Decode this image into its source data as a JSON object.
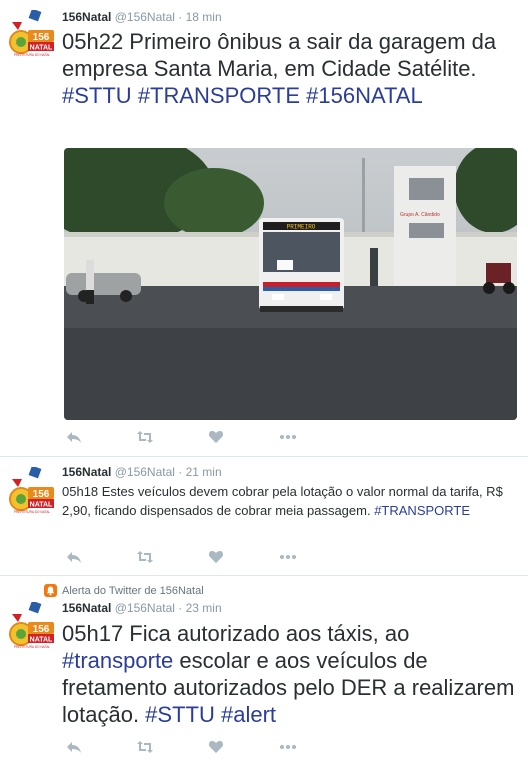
{
  "tweets": [
    {
      "name": "156Natal",
      "handle": "@156Natal",
      "sep": "·",
      "time": "18 min",
      "text_parts": [
        {
          "t": "05h22 Primeiro ônibus a sair da garagem da empresa Santa Maria, em Cidade Satélite. ",
          "ht": false
        },
        {
          "t": "#STTU",
          "ht": true
        },
        {
          "t": " ",
          "ht": false
        },
        {
          "t": "#TRANSPORTE",
          "ht": true
        },
        {
          "t": " ",
          "ht": false
        },
        {
          "t": "#156NATAL",
          "ht": true
        }
      ],
      "photo": {
        "bus_sign": "PRIMEIRO",
        "wall_sign": "Grupo A. Cândido"
      }
    },
    {
      "name": "156Natal",
      "handle": "@156Natal",
      "sep": "·",
      "time": "21 min",
      "text_parts": [
        {
          "t": "05h18 Estes veículos devem cobrar pela lotação o valor normal da tarifa, R$ 2,90, ficando dispensados de cobrar meia passagem. ",
          "ht": false
        },
        {
          "t": "#TRANSPORTE",
          "ht": true
        }
      ]
    },
    {
      "context": "Alerta do Twitter de 156Natal",
      "name": "156Natal",
      "handle": "@156Natal",
      "sep": "·",
      "time": "23 min",
      "text_parts": [
        {
          "t": "05h17 Fica autorizado aos táxis, ao ",
          "ht": false
        },
        {
          "t": "#transporte",
          "ht": true
        },
        {
          "t": " escolar e aos veículos de fretamento autorizados pelo DER a realizarem lotação. ",
          "ht": false
        },
        {
          "t": "#STTU",
          "ht": true
        },
        {
          "t": " ",
          "ht": false
        },
        {
          "t": "#alert",
          "ht": true
        }
      ]
    }
  ],
  "avatar": {
    "number": "156",
    "word": "NATAL",
    "tagline": "PREFEITURA DO NATAL"
  },
  "colors": {
    "hashtag": "#2b3d9b",
    "muted": "#8899a6",
    "text": "#292f33",
    "action": "#aab8c2",
    "alert": "#f4780e"
  },
  "icons": [
    "reply-icon",
    "retweet-icon",
    "like-icon",
    "more-icon",
    "alert-bell-icon"
  ]
}
